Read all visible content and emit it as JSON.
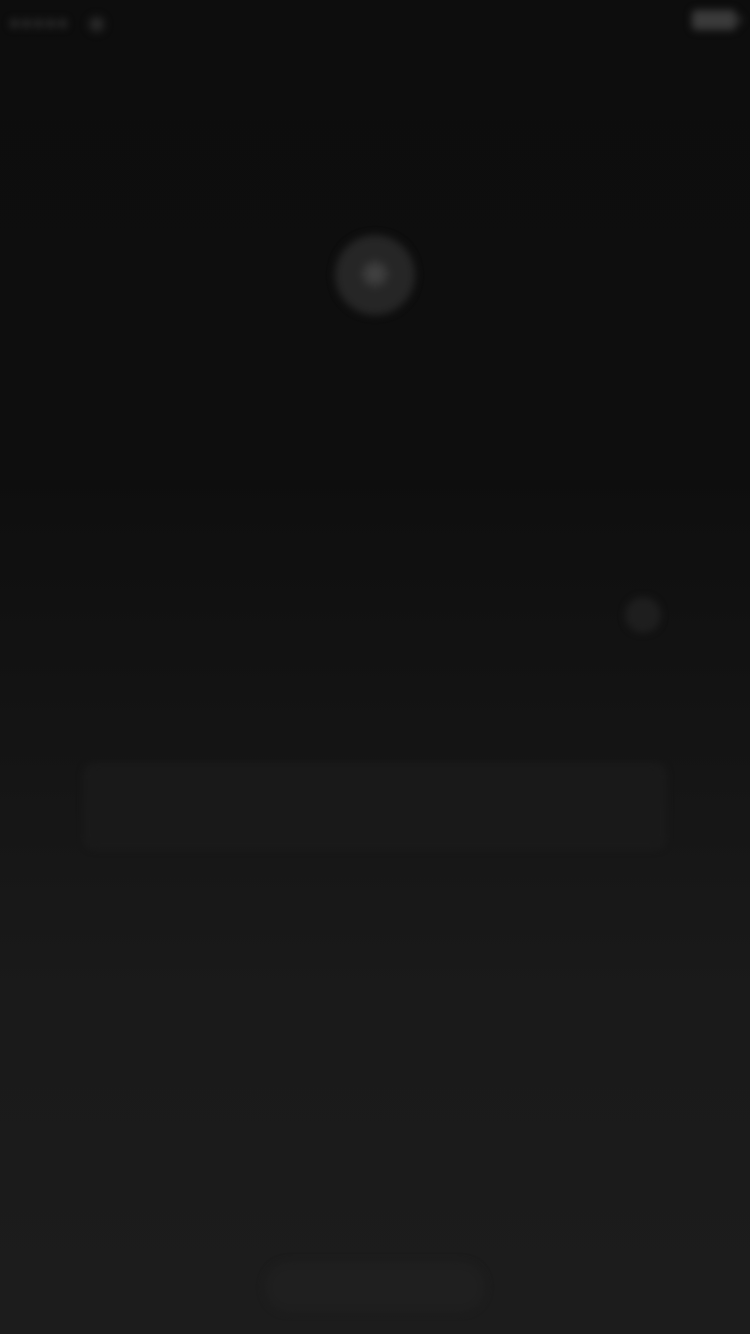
{
  "status_bar": {
    "carrier": "",
    "time": "",
    "battery_percent": ""
  },
  "header": {
    "title": ""
  },
  "profile": {
    "caption": ""
  },
  "form": {
    "account": "",
    "password_placeholder": "",
    "login_label": "",
    "forgot_label": ""
  },
  "footer": {
    "link_label": ""
  },
  "colors": {
    "background_top": "#0d0d0d",
    "background_bottom": "#1c1c1c"
  }
}
